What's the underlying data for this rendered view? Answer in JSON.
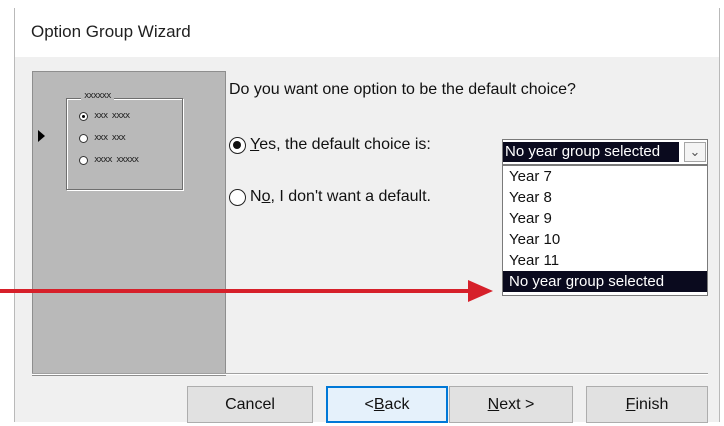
{
  "window": {
    "title": "Option Group Wizard"
  },
  "preview": {
    "group_label": "xxxxxx",
    "items": [
      {
        "label": "xxx xxxx",
        "selected": true
      },
      {
        "label": "xxx xxx",
        "selected": false
      },
      {
        "label": "xxxx xxxxx",
        "selected": false
      }
    ]
  },
  "question": "Do you want one option to be the default choice?",
  "options": {
    "yes": {
      "mnemonic": "Y",
      "rest": "es, the default choice is:",
      "selected": true
    },
    "no": {
      "prefix": "N",
      "mnemonic": "o",
      "rest": ", I don't want a default.",
      "selected": false
    }
  },
  "combo": {
    "value": "No year group selected",
    "options": [
      "Year 7",
      "Year 8",
      "Year 9",
      "Year 10",
      "Year 11",
      "No year group selected"
    ],
    "selected_index": 5
  },
  "buttons": {
    "cancel": "Cancel",
    "back_prefix": "< ",
    "back_mnemonic": "B",
    "back_rest": "ack",
    "next_mnemonic": "N",
    "next_rest": "ext >",
    "finish_mnemonic": "F",
    "finish_rest": "inish"
  },
  "colors": {
    "annotation_arrow": "#d6202a",
    "selection": "#0a0a1e",
    "focus_border": "#0078d7"
  }
}
